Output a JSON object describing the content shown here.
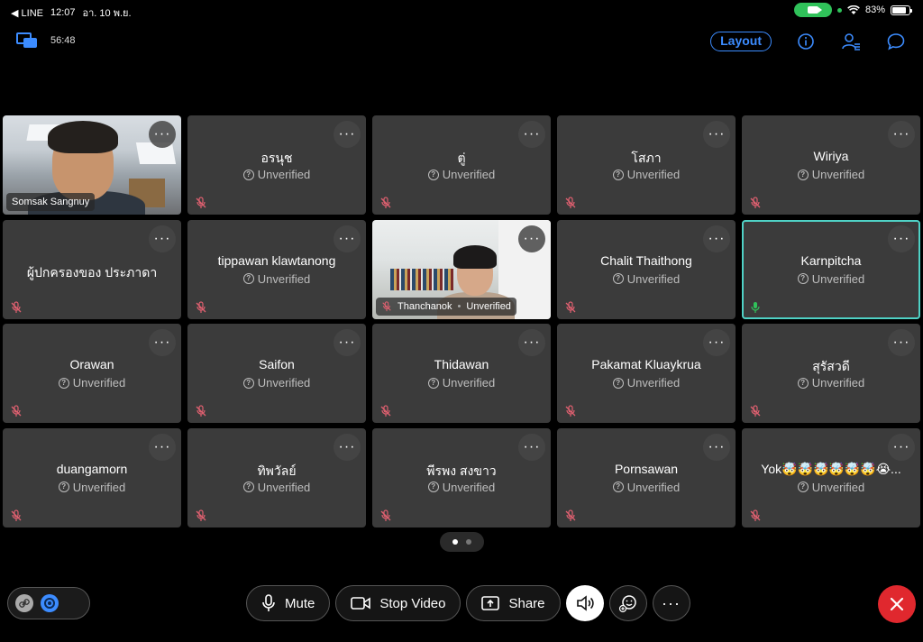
{
  "statusbar": {
    "app_back": "◀ LINE",
    "time": "12:07",
    "date": "อา. 10 พ.ย.",
    "battery": "83%"
  },
  "topbar": {
    "timer": "56:48",
    "layout_label": "Layout"
  },
  "participants": [
    {
      "name": "Somsak Sangnuy",
      "video": true
    },
    {
      "name": "อรนุช",
      "status": "Unverified"
    },
    {
      "name": "ตู่",
      "status": "Unverified"
    },
    {
      "name": "โสภา",
      "status": "Unverified"
    },
    {
      "name": "Wiriya",
      "status": "Unverified"
    },
    {
      "name": "ผู้ปกครองของ ประภาดา"
    },
    {
      "name": "tippawan klawtanong",
      "status": "Unverified"
    },
    {
      "name": "Thanchanok",
      "status": "Unverified",
      "video": true
    },
    {
      "name": "Chalit Thaithong",
      "status": "Unverified"
    },
    {
      "name": "Karnpitcha",
      "status": "Unverified",
      "active": true
    },
    {
      "name": "Orawan",
      "status": "Unverified"
    },
    {
      "name": "Saifon",
      "status": "Unverified"
    },
    {
      "name": "Thidawan",
      "status": "Unverified"
    },
    {
      "name": "Pakamat Kluaykrua",
      "status": "Unverified"
    },
    {
      "name": "สุรัสวดี",
      "status": "Unverified"
    },
    {
      "name": "duangamorn",
      "status": "Unverified"
    },
    {
      "name": "ทิพวัลย์",
      "status": "Unverified"
    },
    {
      "name": "พีรพง สงขาว",
      "status": "Unverified"
    },
    {
      "name": "Pornsawan",
      "status": "Unverified"
    },
    {
      "name": "Yok🤯🤯🤯🤯🤯🤯😭...",
      "status": "Unverified"
    }
  ],
  "controls": {
    "mute_label": "Mute",
    "stop_video_label": "Stop Video",
    "share_label": "Share"
  },
  "colors": {
    "accent": "#3c8cff",
    "active_outline": "#4fd1c5",
    "muted_mic": "#e06070",
    "end_call": "#e0282e",
    "camera_pill": "#30c25a"
  }
}
